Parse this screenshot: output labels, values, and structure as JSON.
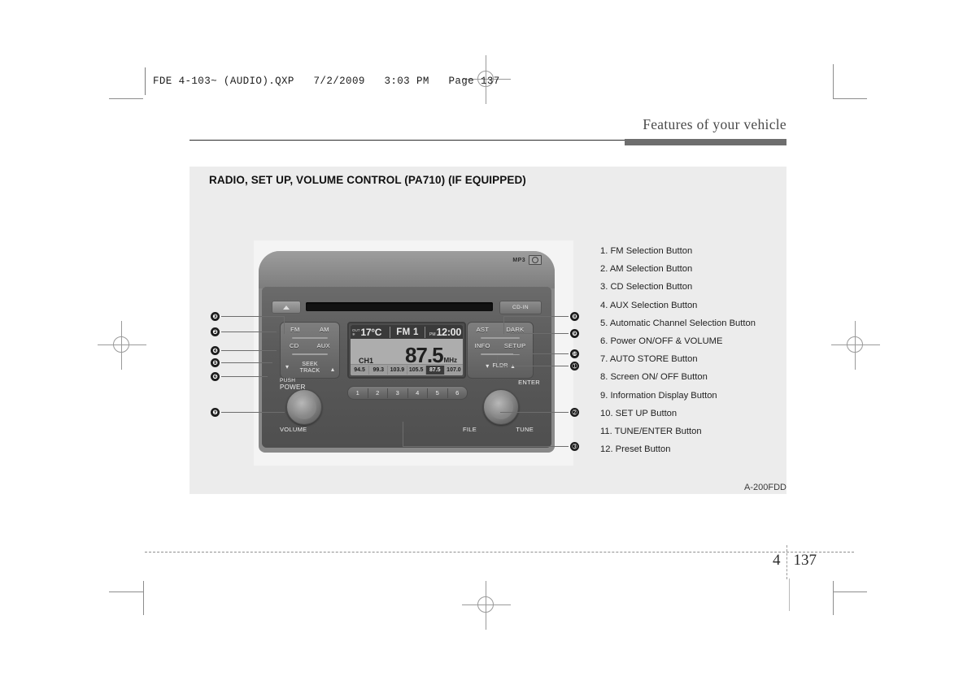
{
  "print_header": {
    "qxp_line": "FDE 4-103~ (AUDIO).QXP   7/2/2009   3:03 PM   Page 137"
  },
  "running_head": {
    "title": "Features of your vehicle"
  },
  "panel": {
    "title": "RADIO, SET UP, VOLUME CONTROL (PA710) (IF EQUIPPED)",
    "figure_code": "A-200FDD"
  },
  "legend": {
    "items": [
      "1. FM Selection Button",
      "2. AM Selection Button",
      "3. CD Selection Button",
      "4. AUX Selection Button",
      "5. Automatic Channel Selection Button",
      "6. Power ON/OFF & VOLUME",
      "7. AUTO STORE Button",
      "8. Screen ON/ OFF Button",
      "9. Information Display Button",
      "10. SET UP Button",
      "11. TUNE/ENTER Button",
      "12. Preset Button"
    ]
  },
  "head_unit": {
    "logos": {
      "mp3": "MP3",
      "cd_icon": "compact-disc-icon"
    },
    "eject_icon": "eject-icon",
    "cd_in_label": "CD-IN",
    "left_buttons": {
      "fm": "FM",
      "am": "AM",
      "cd": "CD",
      "aux": "AUX",
      "seek_down_icon": "chevron-down-icon",
      "seek_up_icon": "chevron-up-icon",
      "seek_line1": "SEEK",
      "seek_line2": "TRACK"
    },
    "right_buttons": {
      "ast": "AST",
      "dark": "DARK",
      "info": "INFO",
      "setup": "SETUP",
      "fldr_down_icon": "chevron-down-icon",
      "fldr_up_icon": "chevron-up-icon",
      "fldr": "FLDR"
    },
    "left_knob": {
      "top_line1": "PUSH",
      "top_line2": "POWER",
      "bottom": "VOLUME"
    },
    "right_knob": {
      "enter": "ENTER",
      "file": "FILE",
      "tune": "TUNE"
    },
    "display": {
      "temp_icon_line1": "OUT",
      "temp_icon_line2": "❄",
      "temperature": "17°C",
      "band": "FM 1",
      "clock_prefix": "PM",
      "clock": "12:00",
      "channel": "CH1",
      "frequency": "87.5",
      "frequency_unit": "MHz",
      "preset_freqs": [
        "94.5",
        "99.3",
        "103.9",
        "105.5",
        "87.5",
        "107.0"
      ],
      "active_preset_index": 4
    },
    "preset_buttons": [
      "1",
      "2",
      "3",
      "4",
      "5",
      "6"
    ]
  },
  "callouts": {
    "left": [
      "❸",
      "❷",
      "❹",
      "❺",
      "❻",
      "❼"
    ],
    "right": [
      "❽",
      "❾",
      "❿",
      "➀",
      "➁",
      "➂"
    ]
  },
  "footer": {
    "chapter": "4",
    "page": "137"
  }
}
